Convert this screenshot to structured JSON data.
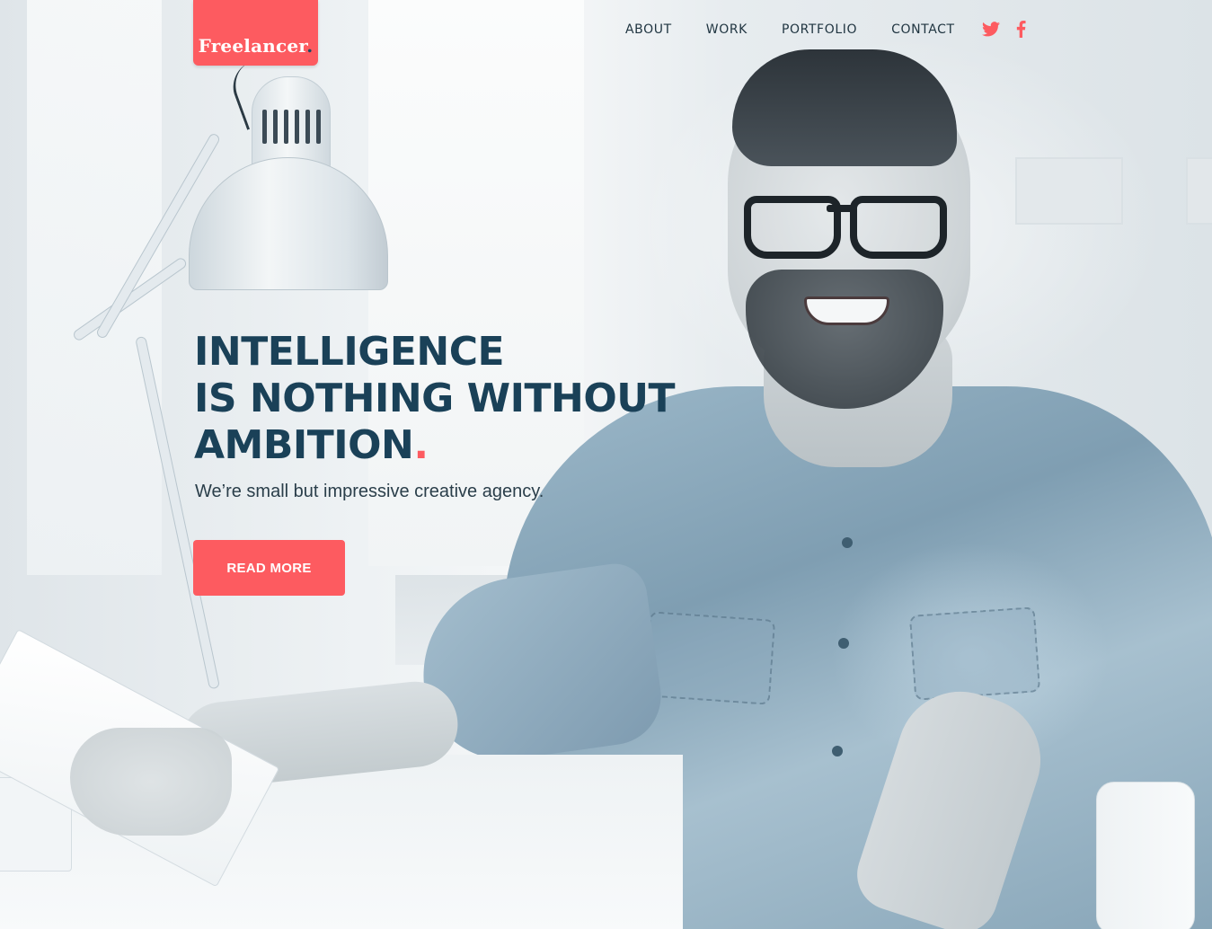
{
  "brand": {
    "name": "Freelancer",
    "dot": ".",
    "color": "#fd5b60"
  },
  "nav": {
    "items": [
      {
        "label": "ABOUT"
      },
      {
        "label": "WORK"
      },
      {
        "label": "PORTFOLIO"
      },
      {
        "label": "CONTACT"
      }
    ],
    "social": [
      {
        "icon": "twitter-icon"
      },
      {
        "icon": "facebook-icon"
      }
    ]
  },
  "hero": {
    "headline_line1": "INTELLIGENCE",
    "headline_line2": "IS NOTHING WITHOUT",
    "headline_line3": "AMBITION",
    "headline_accent": ".",
    "subline": "We’re small but impressive creative agency.",
    "cta_label": "READ MORE",
    "headline_color": "#1a4158",
    "accent_color": "#fd5b60"
  }
}
